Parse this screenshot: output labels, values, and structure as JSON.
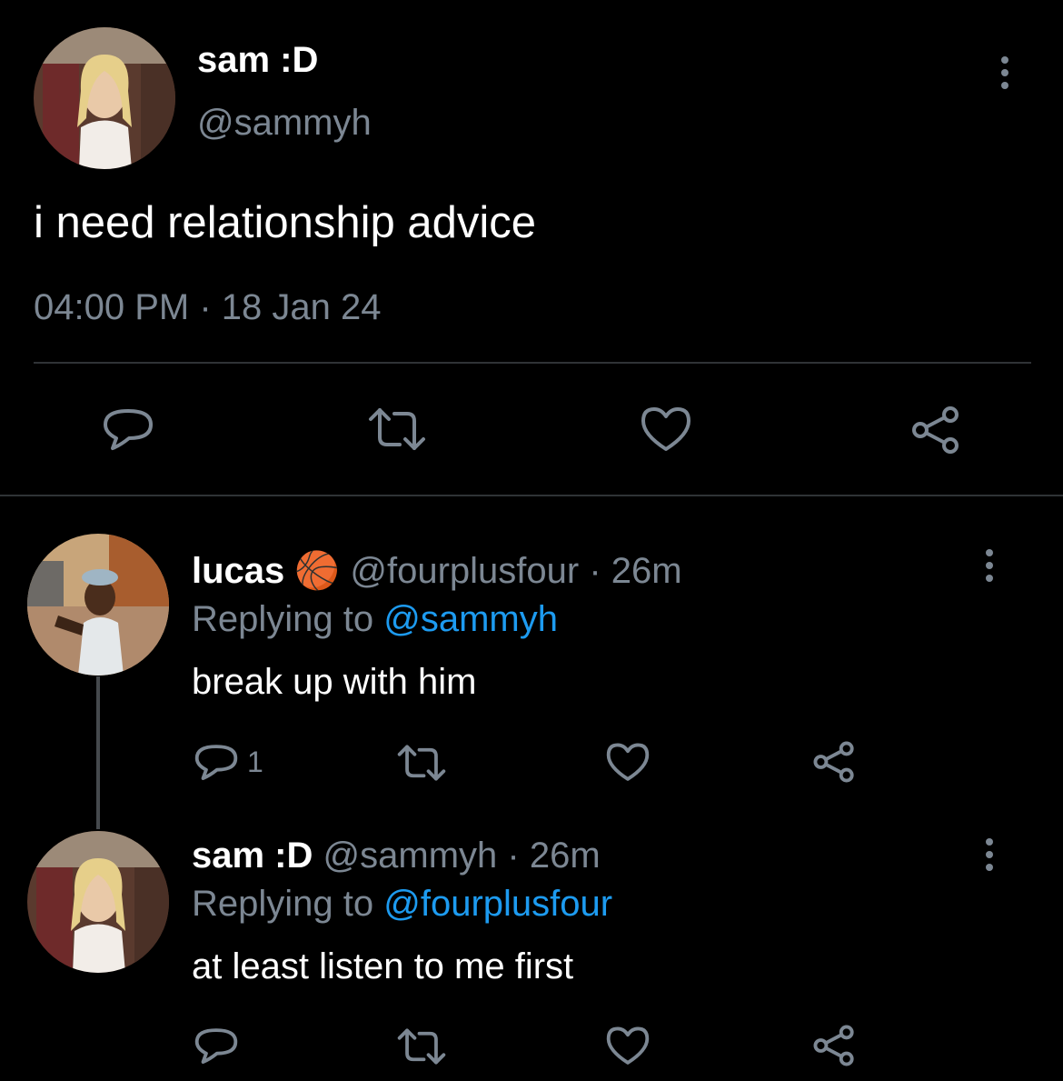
{
  "main_tweet": {
    "display_name": "sam :D",
    "handle": "@sammyh",
    "text": "i need relationship advice",
    "timestamp": "04:00 PM · 18 Jan 24"
  },
  "replies": [
    {
      "display_name": "lucas",
      "emoji": "🏀",
      "handle": "@fourplusfour",
      "age": "· 26m",
      "replying_label": "Replying to",
      "replying_to": "@sammyh",
      "text": "break up with him",
      "reply_count": "1"
    },
    {
      "display_name": "sam :D",
      "handle": "@sammyh",
      "age": "· 26m",
      "replying_label": "Replying to",
      "replying_to": "@fourplusfour",
      "text": "at least listen to me first"
    }
  ],
  "icons": [
    "reply-icon",
    "retweet-icon",
    "like-icon",
    "share-icon",
    "more-icon"
  ],
  "colors": {
    "background": "#000000",
    "muted": "#7c8793",
    "link": "#1d9bf0",
    "divider": "#2f3336"
  }
}
